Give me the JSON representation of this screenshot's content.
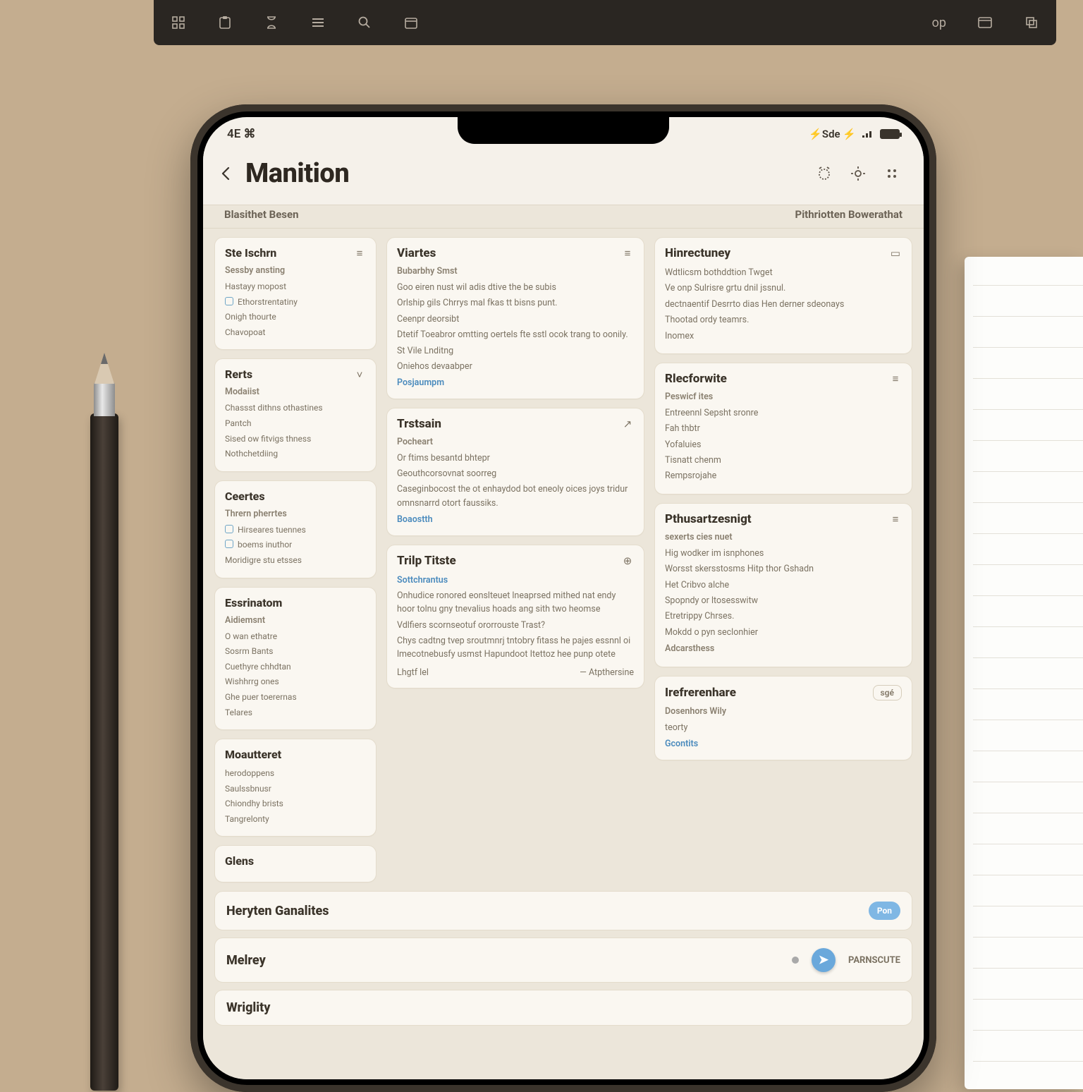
{
  "desktop_toolbar": {
    "channel_label": "op"
  },
  "statusbar": {
    "left": "4E ⌘",
    "right_label": "⚡Sde ⚡"
  },
  "header": {
    "title": "Manition",
    "section_left": "Blasithet Besen",
    "section_right": "Pithriotten Bowerathat"
  },
  "left_cards": [
    {
      "title": "Ste Ischrn",
      "icon": "≡",
      "sub": "Sessby ansting",
      "lines": [
        "Hastayy mopost",
        "Ethorstrentatiny",
        "Onigh thourte",
        "Chavopoat"
      ]
    },
    {
      "title": "Rerts",
      "icon": "˅",
      "sub": "Modaiist",
      "lines": [
        "Chassst dithns othastines",
        "Pantch",
        "Sised ow fitvigs thness",
        "Nothchetdiing"
      ]
    },
    {
      "title": "Ceertes",
      "sub": "Thrern pherrtes",
      "lines": [
        "Hirseares tuennes",
        "boems inuthor",
        "Moridigre stu etsses"
      ]
    },
    {
      "title": "Essrinatom",
      "sub": "Aidiemsnt",
      "lines": [
        "O wan ethatre",
        "Sosrm Bants",
        "Cuethyre chhdtan",
        "Wishhrrg ones",
        "Ghe puer toerernas",
        "Telares"
      ]
    },
    {
      "title": "Moautteret",
      "sub": "",
      "lines": [
        "herodoppens",
        "Saulssbnusr",
        "Chiondhy brists",
        "Tangrelonty"
      ]
    },
    {
      "title": "Glens",
      "sub": "",
      "lines": []
    }
  ],
  "mid_cards": [
    {
      "title": "Viartes",
      "icon": "≡",
      "sub": "Bubarbhy Smst",
      "lines": [
        "Goo eiren nust wil adis dtive the be subis",
        "Orlship gils Chrrys mal fkas tt bisns punt.",
        "Ceenpr deorsibt",
        "Dtetif Toeabror omtting oertels fte sstl ocok trang to oonily.",
        "St Vile Lnditng",
        "Oniehos devaabper"
      ],
      "link": "Posjaumpm"
    },
    {
      "title": "Trstsain",
      "icon": "↗",
      "sub": "Pocheart",
      "lines": [
        "Or ftims besantd bhtepr",
        "Geouthcorsovnat soorreg",
        "Caseginbocost the ot enhaydod bot eneoly oices joys tridur omnsnarrd otort faussiks."
      ],
      "link": "Boaostth"
    },
    {
      "title": "Trilp Titste",
      "icon": "⊕",
      "sub": "",
      "link_top": "Sottchrantus",
      "lines": [
        "Onhudice ronored eonslteuet lneaprsed mithed nat endy hoor tolnu gny tnevalius hoads ang sith two heomse",
        "Vdlfiers scornseotuf ororrouste Trast?",
        "Chys cadtng tvep sroutmnrj tntobry fitass he pajes essnnl oi lmecotnebusfy usmst Hapundoot Itettoz hee punp otete"
      ],
      "footer_left": "Lhgtf lel",
      "footer_right": "— Atpthersine"
    }
  ],
  "right_cards": [
    {
      "title": "Hinrectuney",
      "icon": "▭",
      "sub": "",
      "lines": [
        "Wdtlicsm bothddtion Twget",
        "Ve onp Sulrisre grtu dnil jssnul.",
        "dectnaentif Desrrto dias Hen derner sdeonays",
        "Thootad ordy teamrs.",
        "Inomex"
      ]
    },
    {
      "title": "Rlecforwite",
      "icon": "≡",
      "sub": "Peswicf ites",
      "lines": [
        "Entreennl Sepsht sronre",
        "Fah thbtr",
        "Yofaluies",
        "Tisnatt chenm",
        "Rempsrojahe"
      ]
    },
    {
      "title": "Pthusartzesnigt",
      "icon": "≡",
      "sub": "sexerts cies nuet",
      "sub2": "Adcarsthess",
      "lines": [
        "Hig wodker im isnphones",
        "Worsst skersstosms Hitp thor Gshadn",
        "Het Cribvo alche",
        "Spopndy or ltosesswitw",
        "Etretrippy Chrses.",
        "Mokdd o pyn seclonhier"
      ]
    },
    {
      "title": "Irefrerenhare",
      "badge": "sgé",
      "sub": "Dosenhors Wily",
      "lines": [
        "teorty"
      ],
      "link": "Gcontits"
    }
  ],
  "wide_rows": [
    {
      "title": "Heryten Ganalites",
      "right_kind": "pill",
      "right_label": "Pon"
    },
    {
      "title": "Melrey",
      "right_kind": "fab",
      "dot": true,
      "right_label": "PARNSCUTE"
    },
    {
      "title": "Wriglity",
      "right_kind": "none"
    }
  ]
}
